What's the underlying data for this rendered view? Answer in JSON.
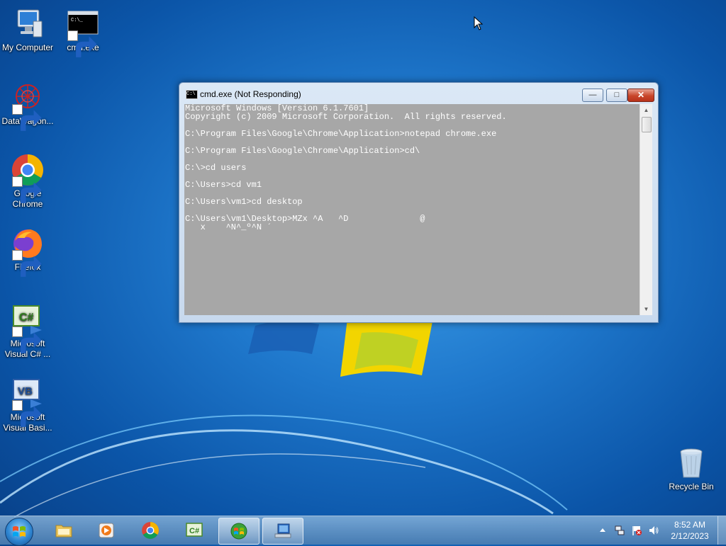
{
  "desktop": {
    "icons": [
      {
        "label": "My Computer"
      },
      {
        "label": "cmd.exe"
      },
      {
        "label": "DataWagon..."
      },
      {
        "label": "Google Chrome"
      },
      {
        "label": "Firefox"
      },
      {
        "label": "Microsoft Visual C# ..."
      },
      {
        "label": "Microsoft Visual Basi..."
      },
      {
        "label": "Recycle Bin"
      }
    ]
  },
  "window": {
    "title": "cmd.exe (Not Responding)",
    "icon_text": "C:\\",
    "buttons": {
      "minimize": "—",
      "maximize": "□",
      "close": "✕"
    },
    "console_lines": [
      "Microsoft Windows [Version 6.1.7601]",
      "Copyright (c) 2009 Microsoft Corporation.  All rights reserved.",
      "",
      "C:\\Program Files\\Google\\Chrome\\Application>notepad chrome.exe",
      "",
      "C:\\Program Files\\Google\\Chrome\\Application>cd\\",
      "",
      "C:\\>cd users",
      "",
      "C:\\Users>cd vm1",
      "",
      "C:\\Users\\vm1>cd desktop",
      "",
      "C:\\Users\\vm1\\Desktop>MZx ^A   ^D              @",
      "   x    ^N^_º^N ´"
    ]
  },
  "taskbar": {
    "items": [
      "start-orb",
      "windows-explorer",
      "media-player",
      "google-chrome",
      "visual-csharp",
      "windows-media-center",
      "cmd-window"
    ],
    "clock": {
      "time": "8:52 AM",
      "date": "2/12/2023"
    }
  },
  "colors": {
    "console_bg": "#a7a7a7",
    "console_fg": "#ffffff"
  }
}
